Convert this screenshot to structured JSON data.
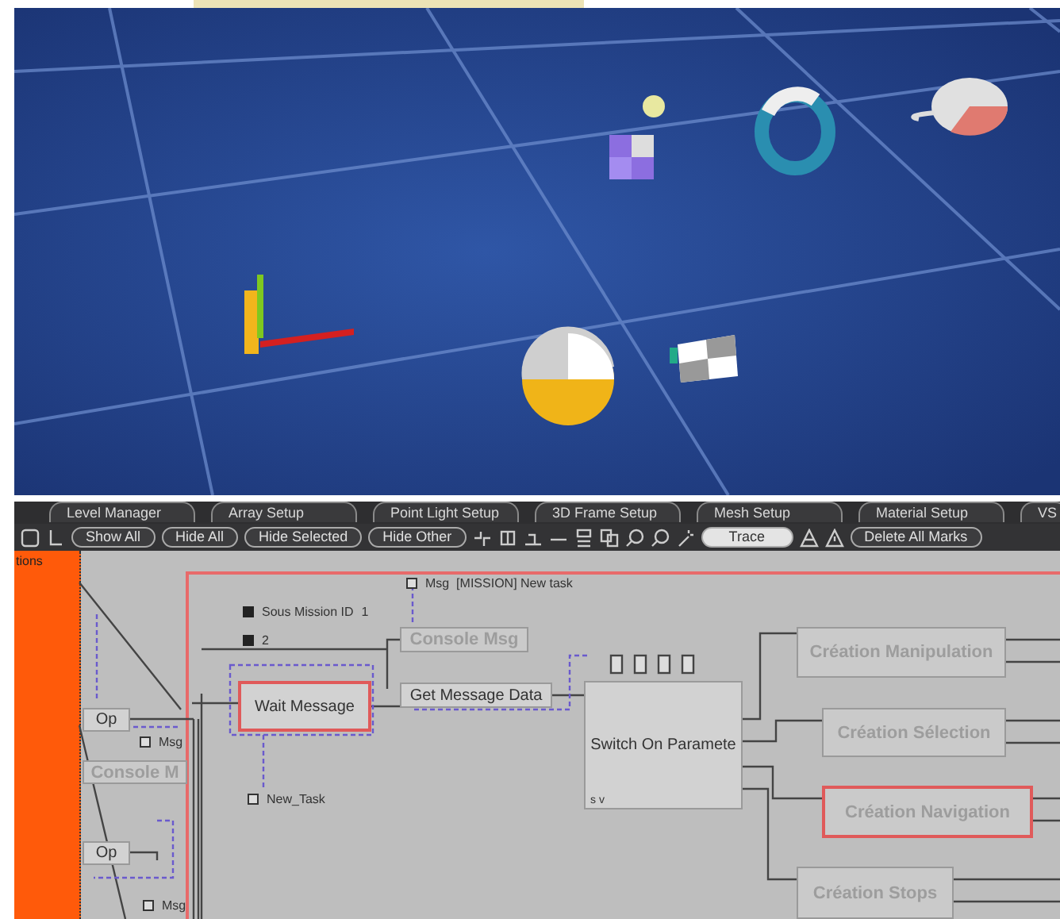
{
  "tabs": [
    {
      "label": "Level Manager"
    },
    {
      "label": "Array Setup"
    },
    {
      "label": "Point Light Setup"
    },
    {
      "label": "3D Frame Setup"
    },
    {
      "label": "Mesh Setup"
    },
    {
      "label": "Material Setup"
    },
    {
      "label": "VS"
    }
  ],
  "toolbar": {
    "buttons": [
      {
        "label": "Show All"
      },
      {
        "label": "Hide All"
      },
      {
        "label": "Hide Selected"
      },
      {
        "label": "Hide Other"
      },
      {
        "label": "Trace"
      },
      {
        "label": "Delete All Marks"
      }
    ]
  },
  "side_panel": {
    "label": "tions"
  },
  "graph": {
    "nodes": [
      {
        "kind": "block",
        "label": "Op",
        "faded": false,
        "highlighted": false
      },
      {
        "kind": "param",
        "label": "Msg"
      },
      {
        "kind": "block",
        "label": "Console M",
        "faded": true,
        "highlighted": false
      },
      {
        "kind": "block",
        "label": "Op",
        "faded": false,
        "highlighted": false
      },
      {
        "kind": "param",
        "label": "Msg"
      },
      {
        "kind": "setting",
        "label": "Sous Mission ID",
        "value": "1"
      },
      {
        "kind": "setting",
        "label": "2"
      },
      {
        "kind": "param",
        "label": "Msg  [MISSION] New task"
      },
      {
        "kind": "block",
        "label": "Console Msg",
        "faded": true,
        "highlighted": false
      },
      {
        "kind": "block",
        "label": "Wait Message",
        "faded": false,
        "highlighted": true
      },
      {
        "kind": "param",
        "label": "New_Task"
      },
      {
        "kind": "block",
        "label": "Get Message Data",
        "faded": false,
        "highlighted": false
      },
      {
        "kind": "block",
        "label": "Switch On Paramete",
        "faded": false,
        "highlighted": false,
        "footer": "s v"
      },
      {
        "kind": "block",
        "label": "Création Manipulation",
        "faded": true,
        "highlighted": false
      },
      {
        "kind": "block",
        "label": "Création Sélection",
        "faded": true,
        "highlighted": false
      },
      {
        "kind": "block",
        "label": "Création Navigation",
        "faded": true,
        "highlighted": true
      },
      {
        "kind": "block",
        "label": "Création Stops",
        "faded": true,
        "highlighted": false
      }
    ]
  }
}
